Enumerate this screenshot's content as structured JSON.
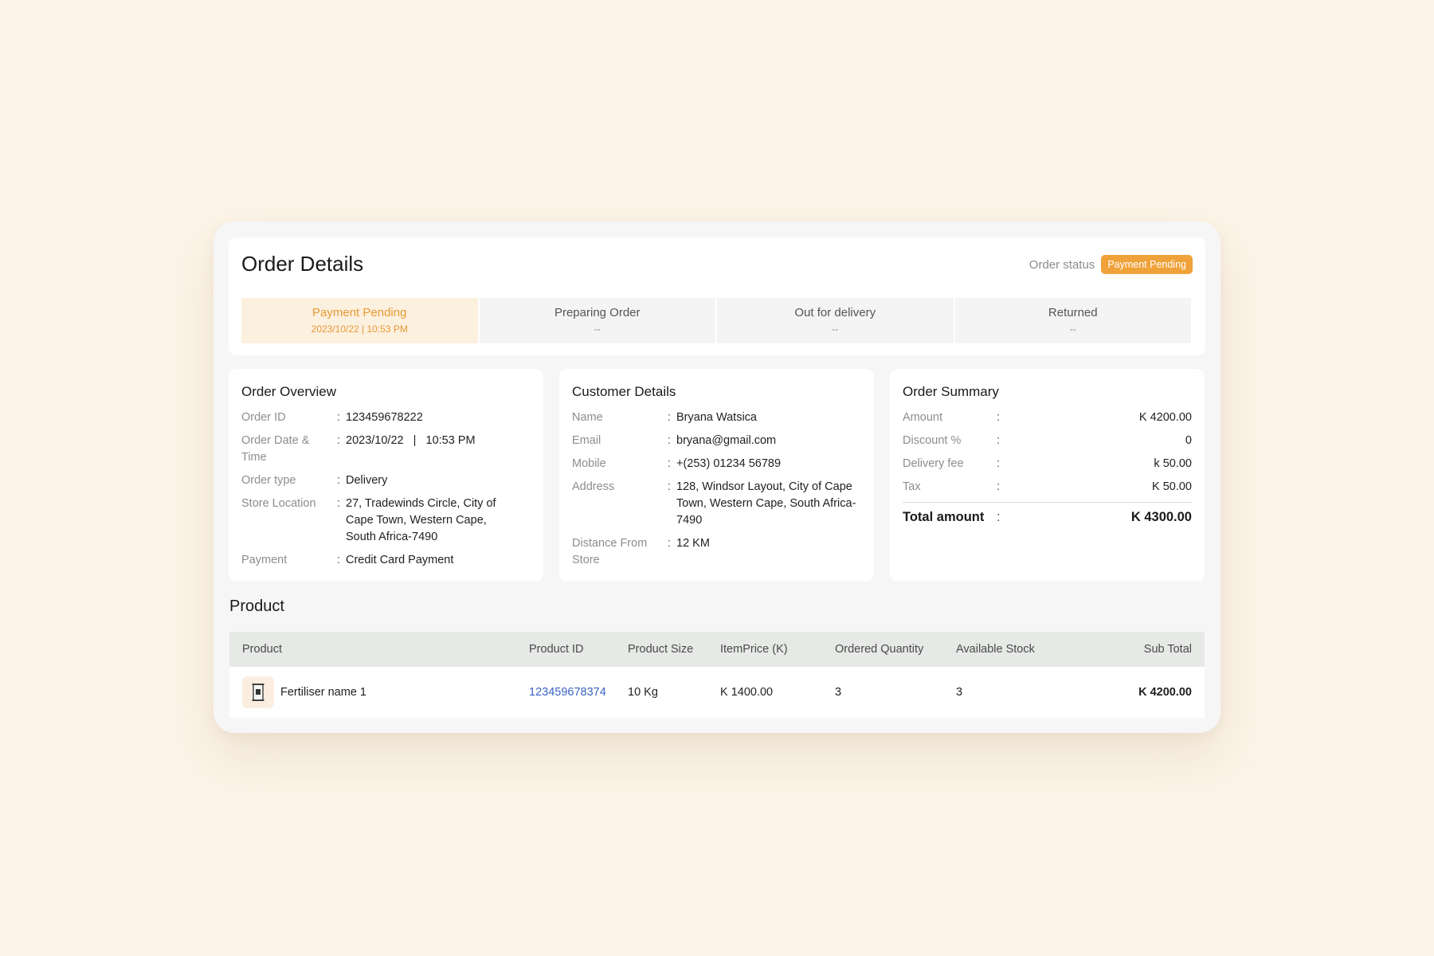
{
  "header": {
    "title": "Order Details",
    "status_label": "Order status",
    "status_badge": "Payment Pending",
    "accent_color": "#f0a23a"
  },
  "steps": [
    {
      "title": "Payment Pending",
      "sub": "2023/10/22  |  10:53 PM",
      "active": true
    },
    {
      "title": "Preparing Order",
      "sub": "--",
      "active": false
    },
    {
      "title": "Out for delivery",
      "sub": "--",
      "active": false
    },
    {
      "title": "Returned",
      "sub": "--",
      "active": false
    }
  ],
  "order_overview": {
    "title": "Order Overview",
    "rows": [
      {
        "label": "Order ID",
        "value": "123459678222"
      },
      {
        "label": "Order Date & Time",
        "value": "2023/10/22   |   10:53 PM"
      },
      {
        "label": "Order type",
        "value": "Delivery"
      },
      {
        "label": "Store Location",
        "value": "27, Tradewinds Circle, City of Cape Town, Western Cape, South Africa-7490"
      },
      {
        "label": "Payment",
        "value": "Credit Card Payment"
      }
    ]
  },
  "customer_details": {
    "title": "Customer Details",
    "rows": [
      {
        "label": "Name",
        "value": "Bryana Watsica"
      },
      {
        "label": "Email",
        "value": "bryana@gmail.com"
      },
      {
        "label": "Mobile",
        "value": "+(253) 01234 56789"
      },
      {
        "label": "Address",
        "value": "128, Windsor Layout, City of Cape Town, Western Cape, South Africa-7490"
      },
      {
        "label": "Distance From Store",
        "value": "12 KM"
      }
    ]
  },
  "order_summary": {
    "title": "Order Summary",
    "rows": [
      {
        "label": "Amount",
        "value": "K 4200.00"
      },
      {
        "label": "Discount %",
        "value": "0"
      },
      {
        "label": "Delivery fee",
        "value": "k 50.00"
      },
      {
        "label": "Tax",
        "value": "K 50.00"
      }
    ],
    "total_label": "Total amount",
    "total_value": "K 4300.00"
  },
  "product_section": {
    "title": "Product",
    "columns": [
      "Product",
      "Product ID",
      "Product Size",
      "ItemPrice (K)",
      "Ordered Quantity",
      "Available Stock",
      "Sub Total"
    ],
    "rows": [
      {
        "name": "Fertiliser name 1",
        "id": "123459678374",
        "size": "10 Kg",
        "price": "K 1400.00",
        "qty": "3",
        "stock": "3",
        "subtotal": "K 4200.00",
        "icon": "fertiliser-bag-icon"
      }
    ]
  }
}
